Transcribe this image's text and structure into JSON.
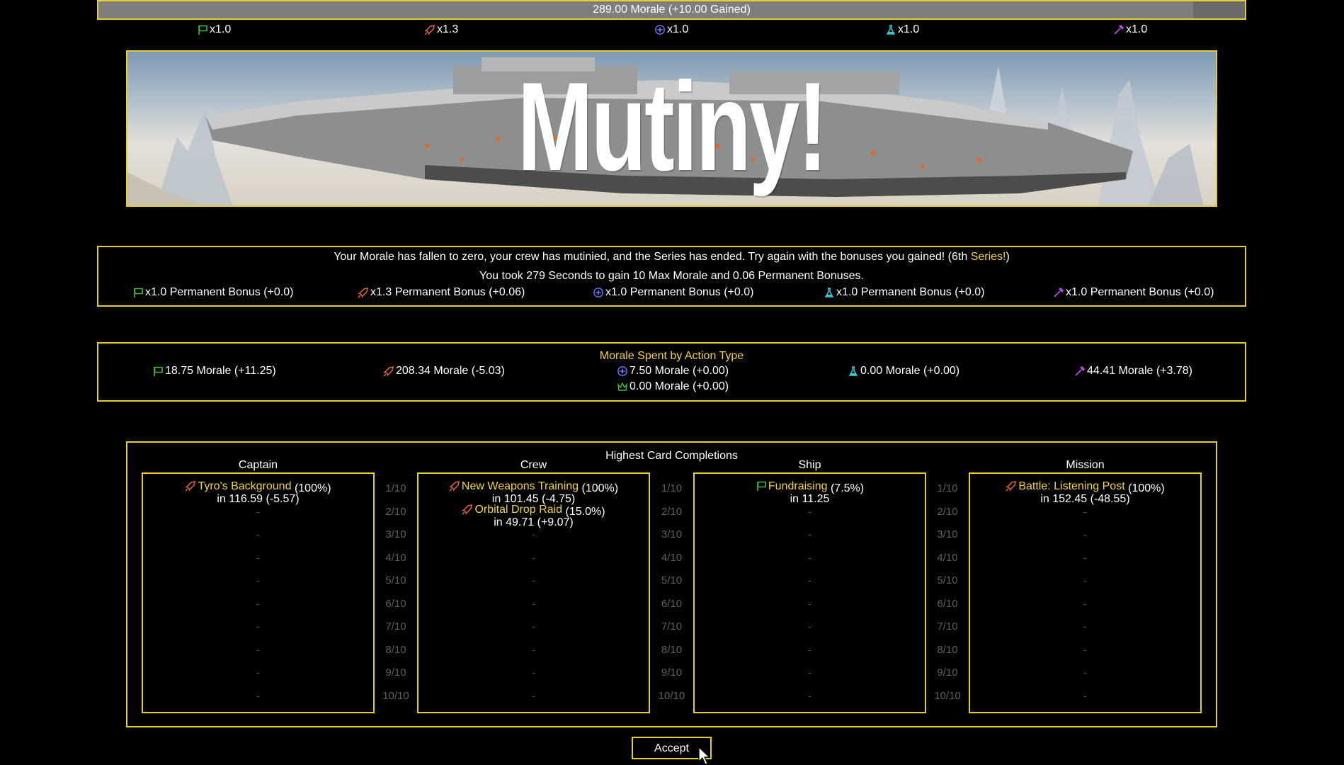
{
  "morale_bar": {
    "text": "289.00 Morale (+10.00 Gained)",
    "fill_fraction": 0.955
  },
  "multipliers": [
    {
      "icon": "flag-icon",
      "color": "#3fbf3f",
      "value": "x1.0"
    },
    {
      "icon": "rocket-icon",
      "color": "#e8643a",
      "value": "x1.3"
    },
    {
      "icon": "compass-icon",
      "color": "#6a7bff",
      "value": "x1.0"
    },
    {
      "icon": "flask-icon",
      "color": "#36c8d8",
      "value": "x1.0"
    },
    {
      "icon": "hammer-icon",
      "color": "#c046e8",
      "value": "x1.0"
    }
  ],
  "banner": {
    "title": "Mutiny!"
  },
  "result": {
    "line1_prefix": "Your Morale has fallen to zero, your crew has mutinied, and the Series has ended.  Try again with the bonuses you gained!  (6th ",
    "line1_series": "Series!",
    "line1_suffix": ")",
    "line2": "You took 279 Seconds to gain 10 Max Morale and 0.06 Permanent Bonuses.",
    "bonuses": [
      {
        "icon": "flag-icon",
        "text": "x1.0 Permanent Bonus (+0.0)"
      },
      {
        "icon": "rocket-icon",
        "text": "x1.3 Permanent Bonus (+0.06)"
      },
      {
        "icon": "compass-icon",
        "text": "x1.0 Permanent Bonus (+0.0)"
      },
      {
        "icon": "flask-icon",
        "text": "x1.0 Permanent Bonus (+0.0)"
      },
      {
        "icon": "hammer-icon",
        "text": "x1.0 Permanent Bonus (+0.0)"
      }
    ]
  },
  "spent": {
    "title": "Morale Spent by Action Type",
    "items": [
      {
        "icon": "flag-icon",
        "text": "18.75 Morale (+11.25)"
      },
      {
        "icon": "rocket-icon",
        "text": "208.34 Morale (-5.03)"
      },
      {
        "icon": "compass-icon",
        "text": "7.50 Morale (+0.00)"
      },
      {
        "icon": "flask-icon",
        "text": "0.00 Morale (+0.00)"
      },
      {
        "icon": "hammer-icon",
        "text": "44.41 Morale (+3.78)"
      },
      {
        "icon": "crown-icon",
        "text": "0.00 Morale (+0.00)"
      }
    ]
  },
  "cards": {
    "title": "Highest Card Completions",
    "dash": "-",
    "ranks": [
      "1/10",
      "2/10",
      "3/10",
      "4/10",
      "5/10",
      "6/10",
      "7/10",
      "8/10",
      "9/10",
      "10/10"
    ],
    "columns": [
      {
        "title": "Captain",
        "entries": [
          {
            "icon": "rocket-icon",
            "name": "Tyro's Background",
            "pct": "(100%)",
            "time": "in 116.59 (-5.57)"
          }
        ]
      },
      {
        "title": "Crew",
        "entries": [
          {
            "icon": "rocket-icon",
            "name": "New Weapons Training",
            "pct": "(100%)",
            "time": "in 101.45 (-4.75)"
          },
          {
            "icon": "rocket-icon",
            "name": "Orbital Drop Raid",
            "pct": "(15.0%)",
            "time": "in 49.71 (+9.07)"
          }
        ]
      },
      {
        "title": "Ship",
        "entries": [
          {
            "icon": "flag-icon",
            "name": "Fundraising",
            "pct": "(7.5%)",
            "time": "in 11.25"
          }
        ]
      },
      {
        "title": "Mission",
        "entries": [
          {
            "icon": "rocket-icon",
            "name": "Battle: Listening Post",
            "pct": "(100%)",
            "time": "in 152.45 (-48.55)"
          }
        ]
      }
    ]
  },
  "accept_label": "Accept"
}
